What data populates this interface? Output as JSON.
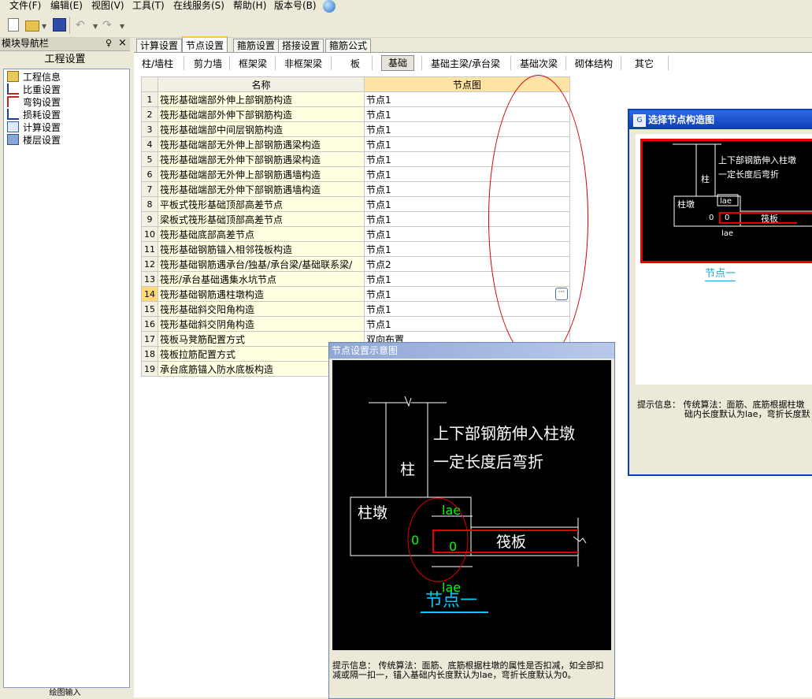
{
  "menu": [
    "文件(F)",
    "编辑(E)",
    "视图(V)",
    "工具(T)",
    "在线服务(S)",
    "帮助(H)",
    "版本号(B)"
  ],
  "nav": {
    "title": "模块导航栏",
    "pin": "♀",
    "close": "×",
    "group": "工程设置",
    "items": [
      "工程信息",
      "比重设置",
      "弯钩设置",
      "损耗设置",
      "计算设置",
      "楼层设置"
    ],
    "bottom": "绘图输入"
  },
  "tabs_top": [
    "计算设置",
    "节点设置",
    "箍筋设置",
    "搭接设置",
    "箍筋公式"
  ],
  "tabs_second": [
    "柱/墙柱",
    "剪力墙",
    "框架梁",
    "非框架梁",
    "板",
    "基础",
    "基础主梁/承台梁",
    "基础次梁",
    "砌体结构",
    "其它"
  ],
  "table": {
    "headers": [
      "",
      "名称",
      "节点图"
    ],
    "rows": [
      {
        "no": "1",
        "name": "筏形基础端部外伸上部钢筋构造",
        "value": "节点1"
      },
      {
        "no": "2",
        "name": "筏形基础端部外伸下部钢筋构造",
        "value": "节点1"
      },
      {
        "no": "3",
        "name": "筏形基础端部中间层钢筋构造",
        "value": "节点1"
      },
      {
        "no": "4",
        "name": "筏形基础端部无外伸上部钢筋遇梁构造",
        "value": "节点1"
      },
      {
        "no": "5",
        "name": "筏形基础端部无外伸下部钢筋遇梁构造",
        "value": "节点1"
      },
      {
        "no": "6",
        "name": "筏形基础端部无外伸上部钢筋遇墙构造",
        "value": "节点1"
      },
      {
        "no": "7",
        "name": "筏形基础端部无外伸下部钢筋遇墙构造",
        "value": "节点1"
      },
      {
        "no": "8",
        "name": "平板式筏形基础顶部高差节点",
        "value": "节点1"
      },
      {
        "no": "9",
        "name": "梁板式筏形基础顶部高差节点",
        "value": "节点1"
      },
      {
        "no": "10",
        "name": "筏形基础底部高差节点",
        "value": "节点1"
      },
      {
        "no": "11",
        "name": "筏形基础钢筋锚入相邻筏板构造",
        "value": "节点1"
      },
      {
        "no": "12",
        "name": "筏形基础钢筋遇承台/独基/承台梁/基础联系梁/",
        "value": "节点2"
      },
      {
        "no": "13",
        "name": "筏形/承台基础遇集水坑节点",
        "value": "节点1"
      },
      {
        "no": "14",
        "name": "筏形基础钢筋遇柱墩构造",
        "value": "节点1"
      },
      {
        "no": "15",
        "name": "筏形基础斜交阳角构造",
        "value": "节点1"
      },
      {
        "no": "16",
        "name": "筏形基础斜交阴角构造",
        "value": "节点1"
      },
      {
        "no": "17",
        "name": "筏板马凳筋配置方式",
        "value": "双向布置"
      },
      {
        "no": "18",
        "name": "筏板拉筋配置方式",
        "value": ""
      },
      {
        "no": "19",
        "name": "承台底筋锚入防水底板构造",
        "value": ""
      }
    ],
    "selected_row": "14",
    "ellipsis_label": "···"
  },
  "dialog_sketch": {
    "title": "节点设置示意图",
    "text_line1": "上下部钢筋伸入柱墩",
    "text_line2": "一定长度后弯折",
    "label_column": "柱",
    "label_pier": "柱墩",
    "label_raft": "筏板",
    "label_lae": "lae",
    "label_zero": "0",
    "caption": "节点一",
    "hint": "提示信息： 传统算法：面筋、底筋根据柱墩的属性是否扣减，如全部扣减或隔一扣一，锚入基础内长度默认为lae，弯折长度默认为0。"
  },
  "dialog_choose": {
    "title": "选择节点构造图",
    "icon": "G",
    "text_line1": "上下部钢筋伸入柱墩",
    "text_line2": "一定长度后弯折",
    "label_column": "柱",
    "label_pier": "柱墩",
    "label_raft": "筏板",
    "label_lae": "lae",
    "label_zero": "0",
    "caption": "节点一",
    "hint_line1": "提示信息：  传统算法：面筋、底筋根据柱墩",
    "hint_line2": "础内长度默认为lae，弯折长度默"
  }
}
